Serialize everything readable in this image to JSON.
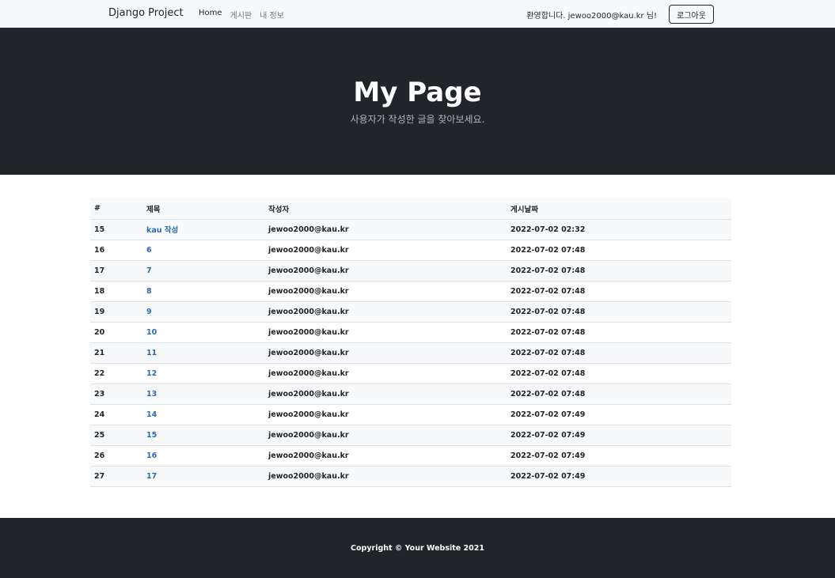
{
  "navbar": {
    "brand": "Django Project",
    "links": [
      "Home",
      "게시판",
      "내 정보"
    ],
    "welcome": "환영합니다. jewoo2000@kau.kr 님!",
    "logout_label": "로그아웃"
  },
  "hero": {
    "title": "My Page",
    "subtitle": "사용자가 작성한 글을 찾아보세요."
  },
  "table": {
    "headers": [
      "#",
      "제목",
      "작성자",
      "게시날짜"
    ],
    "rows": [
      {
        "num": "15",
        "title": "kau 작성",
        "author": "jewoo2000@kau.kr",
        "date": "2022-07-02 02:32"
      },
      {
        "num": "16",
        "title": "6",
        "author": "jewoo2000@kau.kr",
        "date": "2022-07-02 07:48"
      },
      {
        "num": "17",
        "title": "7",
        "author": "jewoo2000@kau.kr",
        "date": "2022-07-02 07:48"
      },
      {
        "num": "18",
        "title": "8",
        "author": "jewoo2000@kau.kr",
        "date": "2022-07-02 07:48"
      },
      {
        "num": "19",
        "title": "9",
        "author": "jewoo2000@kau.kr",
        "date": "2022-07-02 07:48"
      },
      {
        "num": "20",
        "title": "10",
        "author": "jewoo2000@kau.kr",
        "date": "2022-07-02 07:48"
      },
      {
        "num": "21",
        "title": "11",
        "author": "jewoo2000@kau.kr",
        "date": "2022-07-02 07:48"
      },
      {
        "num": "22",
        "title": "12",
        "author": "jewoo2000@kau.kr",
        "date": "2022-07-02 07:48"
      },
      {
        "num": "23",
        "title": "13",
        "author": "jewoo2000@kau.kr",
        "date": "2022-07-02 07:48"
      },
      {
        "num": "24",
        "title": "14",
        "author": "jewoo2000@kau.kr",
        "date": "2022-07-02 07:49"
      },
      {
        "num": "25",
        "title": "15",
        "author": "jewoo2000@kau.kr",
        "date": "2022-07-02 07:49"
      },
      {
        "num": "26",
        "title": "16",
        "author": "jewoo2000@kau.kr",
        "date": "2022-07-02 07:49"
      },
      {
        "num": "27",
        "title": "17",
        "author": "jewoo2000@kau.kr",
        "date": "2022-07-02 07:49"
      }
    ]
  },
  "footer": {
    "copyright": "Copyright © Your Website 2021"
  },
  "colors": {
    "dark": "#212529",
    "navbar_bg": "#f8f9fa",
    "link": "#2a6bb8",
    "muted": "#6c757d"
  }
}
